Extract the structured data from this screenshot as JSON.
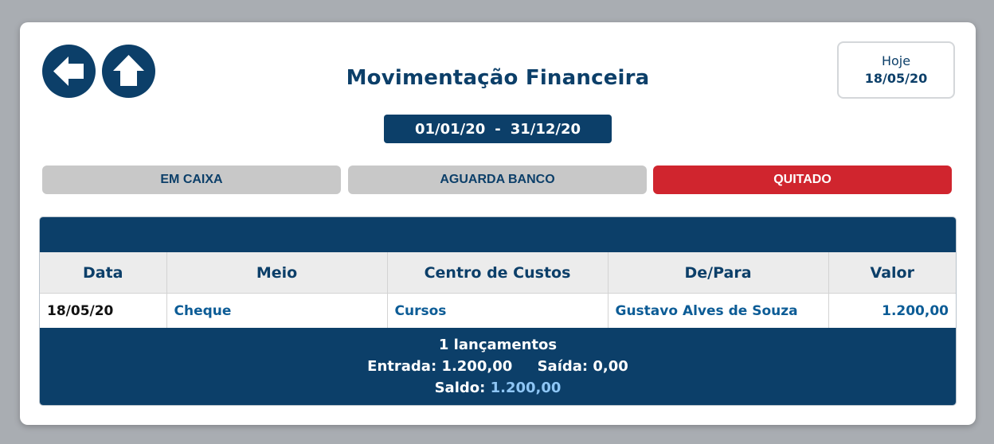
{
  "header": {
    "title": "Movimentação Financeira",
    "today_label": "Hoje",
    "today_value": "18/05/20"
  },
  "period": {
    "start": "01/01/20",
    "separator": "-",
    "end": "31/12/20"
  },
  "tabs": [
    {
      "label": "EM CAIXA",
      "active": false
    },
    {
      "label": "AGUARDA BANCO",
      "active": false
    },
    {
      "label": "QUITADO",
      "active": true
    }
  ],
  "table": {
    "columns": [
      "Data",
      "Meio",
      "Centro de Custos",
      "De/Para",
      "Valor"
    ],
    "rows": [
      [
        "18/05/20",
        "Cheque",
        "Cursos",
        "Gustavo Alves de Souza",
        "1.200,00"
      ]
    ]
  },
  "summary": {
    "count_text": "1 lançamentos",
    "entrada_label": "Entrada:",
    "entrada_value": "1.200,00",
    "saida_label": "Saída:",
    "saida_value": "0,00",
    "saldo_label": "Saldo:",
    "saldo_value": "1.200,00"
  },
  "colors": {
    "primary": "#0c3f69",
    "active_tab": "#d0252e",
    "link_text": "#0c5c96",
    "highlight": "#8ec6f5"
  },
  "icons": {
    "back": "arrow-left-icon",
    "up": "arrow-up-icon"
  }
}
